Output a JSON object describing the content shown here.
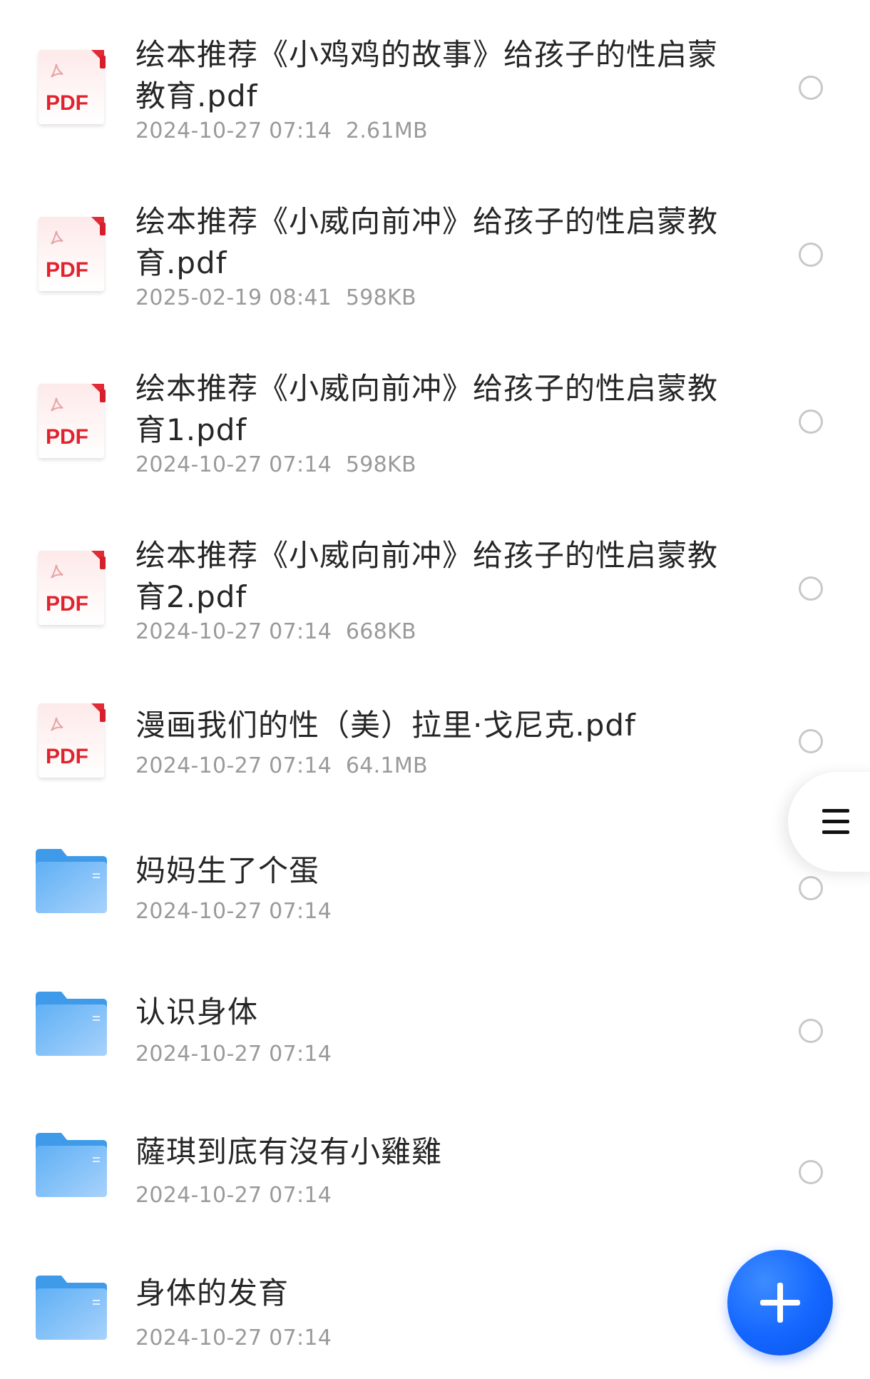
{
  "files": [
    {
      "type": "pdf",
      "line1": "绘本推荐《小鸡鸡的故事》给孩子的性启蒙",
      "line2": "教育.pdf",
      "date": "2024-10-27 07:14",
      "size": "2.61MB"
    },
    {
      "type": "pdf",
      "line1": "绘本推荐《小威向前冲》给孩子的性启蒙教",
      "line2": "育.pdf",
      "date": "2025-02-19 08:41",
      "size": "598KB"
    },
    {
      "type": "pdf",
      "line1": "绘本推荐《小威向前冲》给孩子的性启蒙教",
      "line2": "育1.pdf",
      "date": "2024-10-27 07:14",
      "size": "598KB"
    },
    {
      "type": "pdf",
      "line1": "绘本推荐《小威向前冲》给孩子的性启蒙教",
      "line2": "育2.pdf",
      "date": "2024-10-27 07:14",
      "size": "668KB"
    },
    {
      "type": "pdf",
      "line1": "漫画我们的性（美）拉里·戈尼克.pdf",
      "line2": "",
      "date": "2024-10-27 07:14",
      "size": "64.1MB"
    },
    {
      "type": "folder",
      "line1": "妈妈生了个蛋",
      "line2": "",
      "date": "2024-10-27 07:14",
      "size": ""
    },
    {
      "type": "folder",
      "line1": "认识身体",
      "line2": "",
      "date": "2024-10-27 07:14",
      "size": ""
    },
    {
      "type": "folder",
      "line1": "薩琪到底有沒有小雞雞",
      "line2": "",
      "date": "2024-10-27 07:14",
      "size": ""
    },
    {
      "type": "folder",
      "line1": "身体的发育",
      "line2": "",
      "date": "2024-10-27 07:14",
      "size": ""
    }
  ],
  "pdf_icon_label": "PDF",
  "colors": {
    "accent": "#1366ff",
    "pdf_red": "#e0232e",
    "folder_blue": "#4aa3ef",
    "meta_gray": "#9a9a9a"
  },
  "icons": {
    "fab": "plus-icon",
    "side": "menu-icon",
    "radio": "radio-circle-icon"
  }
}
